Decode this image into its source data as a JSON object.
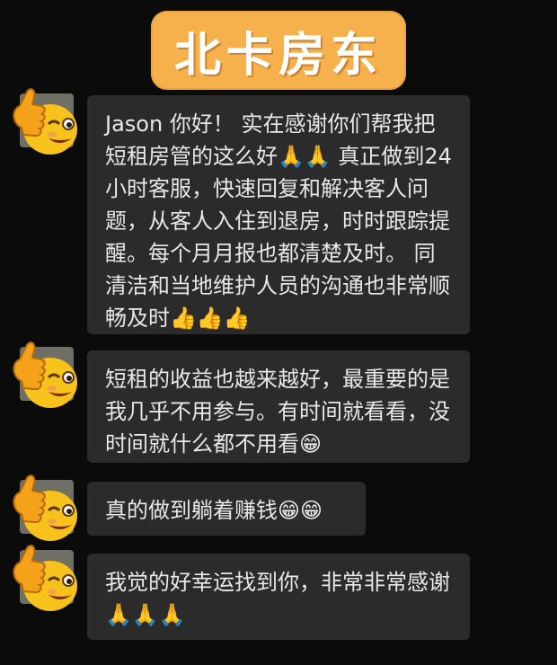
{
  "header": {
    "title": "北卡房东"
  },
  "messages": [
    {
      "text": "Jason 你好！ 实在感谢你们帮我把短租房管的这么好🙏🙏 真正做到24 小时客服，快速回复和解决客人问题，从客人入住到退房，时时跟踪提醒。每个月月报也都清楚及时。 同清洁和当地维护人员的沟通也非常顺畅及时👍👍👍"
    },
    {
      "text": "短租的收益也越来越好，最重要的是我几乎不用参与。有时间就看看，没时间就什么都不用看😁"
    },
    {
      "text": "真的做到躺着赚钱😁😁"
    },
    {
      "text": "我觉的好幸运找到你，非常非常感谢🙏🙏🙏"
    }
  ],
  "avatar": {
    "icon": "thumbs-up-wink-emoji-icon"
  },
  "colors": {
    "badge": "#f6b04c",
    "bubble": "#2b2b2b",
    "background": "#0b0b0b"
  }
}
